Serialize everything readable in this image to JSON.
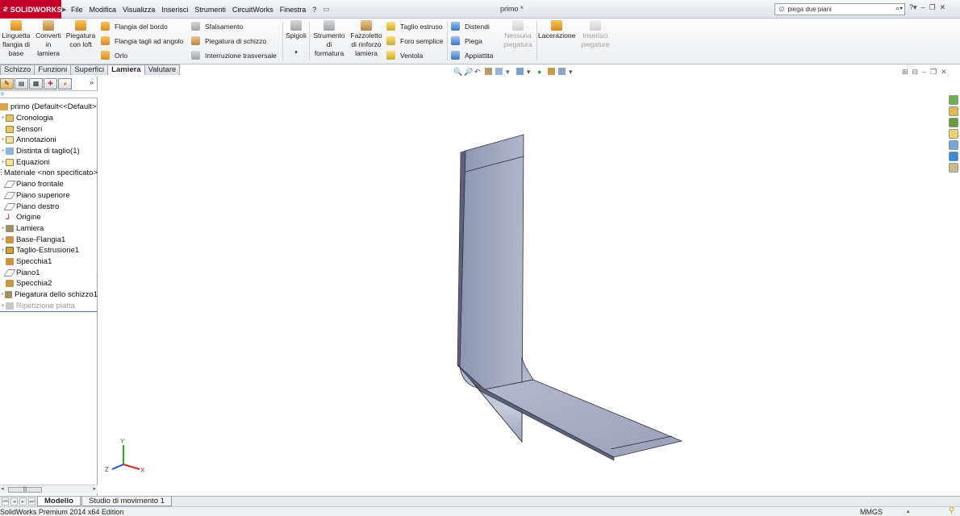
{
  "app": {
    "logo": "SOLIDWORKS",
    "doc_title": "primo *"
  },
  "menu": [
    "File",
    "Modifica",
    "Visualizza",
    "Inserisci",
    "Strumenti",
    "CircuitWorks",
    "Finestra",
    "?"
  ],
  "search": {
    "value": "piega due piani"
  },
  "ribbon": {
    "linguetta": "Linguetta flangia di base",
    "converti": "Converti in lamiera",
    "piegatura_loft": "Piegatura con loft",
    "flangia_bordo": "Flangia del bordo",
    "flangia_tagli": "Flangia tagli ad angolo",
    "orlo": "Orlo",
    "sfalsamento": "Sfalsamento",
    "piegatura_schizzo": "Piegatura di schizzo",
    "interruzione": "Interruzione trasversale",
    "spigoli": "Spigoli",
    "strumento": "Strumento di formatura",
    "fazzoletto": "Fazzoletto di rinforzo lamiera",
    "taglio_estruso": "Taglio estruso",
    "foro_semplice": "Foro semplice",
    "ventola": "Ventola",
    "distendi": "Distendi",
    "piega": "Piega",
    "appiattita": "Appiattita",
    "nessuna_piegatura": "Nessuna piegatura",
    "lacerazione": "Lacerazione",
    "inserisci_piegature": "Inserisci piegature"
  },
  "cm_tabs": [
    "Schizzo",
    "Funzioni",
    "Superfici",
    "Lamiera",
    "Valutare"
  ],
  "cm_active": "Lamiera",
  "tree": {
    "root": "primo  (Default<<Default>",
    "items": [
      "Cronologia",
      "Sensori",
      "Annotazioni",
      "Distinta di taglio(1)",
      "Equazioni",
      "Materiale <non specificato>",
      "Piano frontale",
      "Piano superiore",
      "Piano destro",
      "Origine",
      "Lamiera",
      "Base-Flangia1",
      "Taglio-Estrusione1",
      "Specchia1",
      "Piano1",
      "Specchia2",
      "Piegatura dello schizzo1",
      "Ripetizione piatta"
    ]
  },
  "triad": {
    "x": "X",
    "y": "Y",
    "z": "Z"
  },
  "bottom_tabs": [
    "Modello",
    "Studio di movimento 1"
  ],
  "status": {
    "text": "SolidWorks Premium 2014 x64 Edition",
    "units": "MMGS"
  },
  "colors": {
    "logo_red": "#c6002b",
    "part_face": "#a6abc4",
    "part_edge": "#2a2d38"
  }
}
